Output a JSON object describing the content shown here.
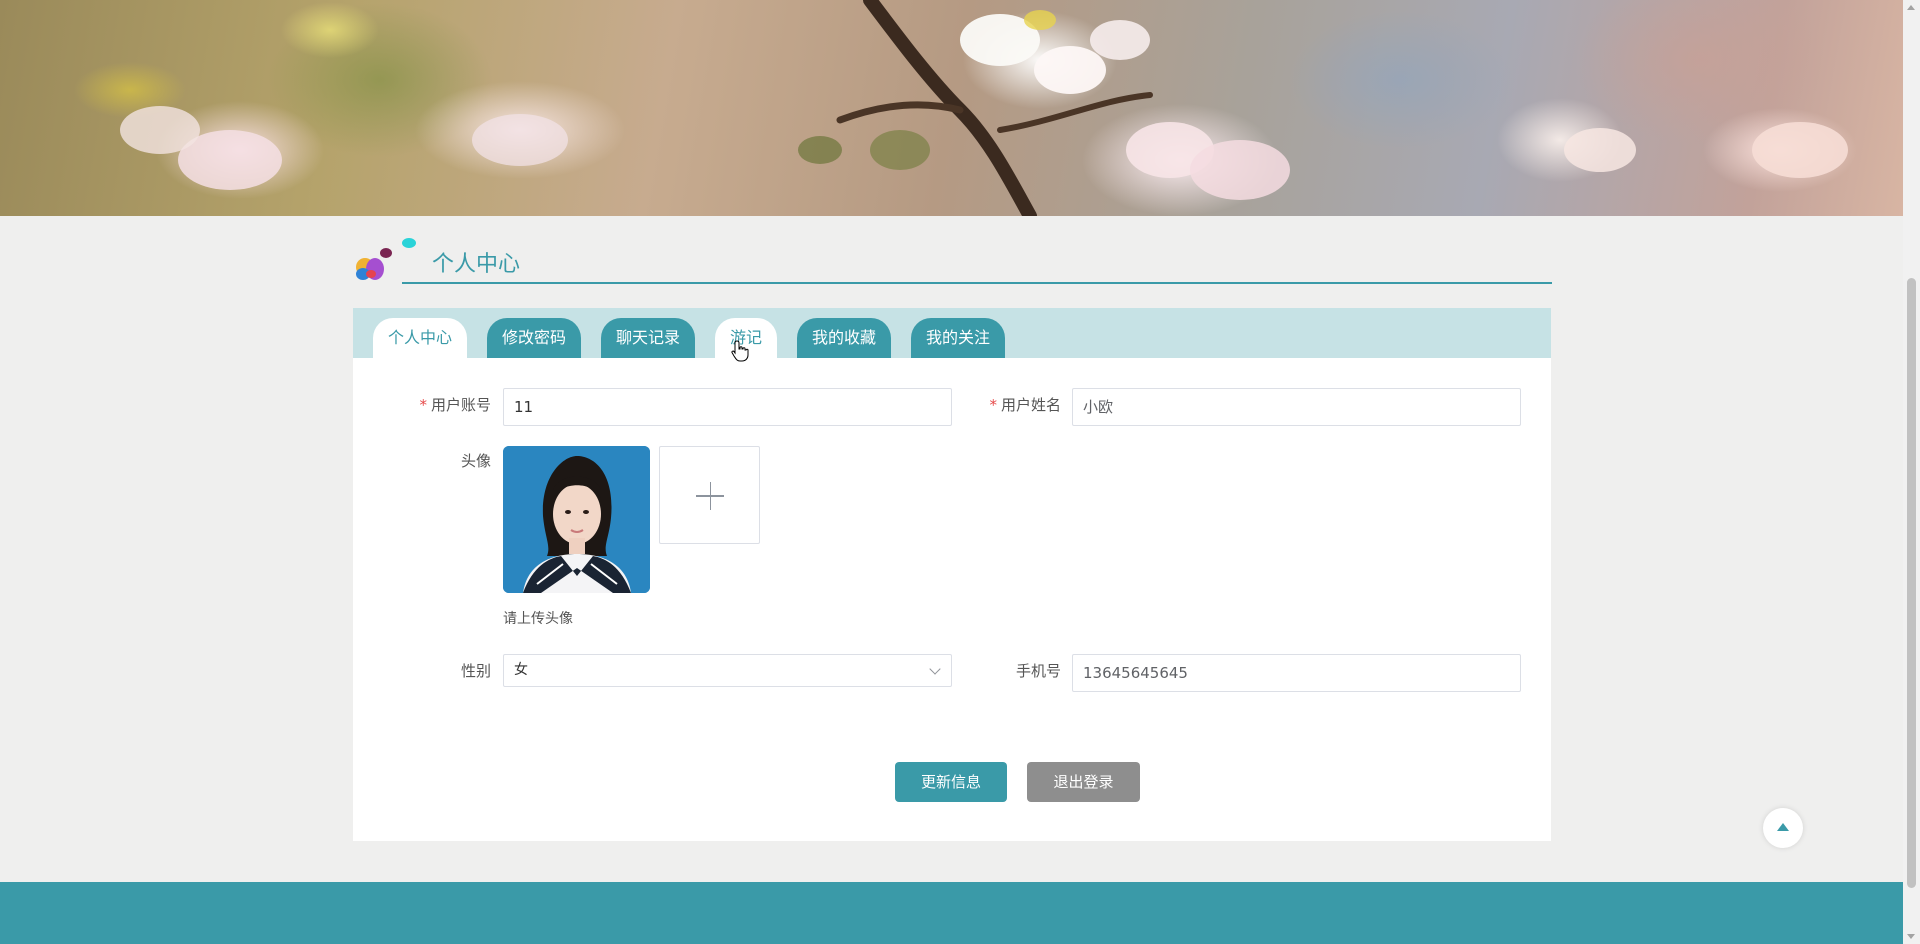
{
  "page": {
    "section_title": "个人中心",
    "accent_color": "#3a9aa8"
  },
  "tabs": [
    {
      "label": "个人中心",
      "active": true
    },
    {
      "label": "修改密码",
      "active": false
    },
    {
      "label": "聊天记录",
      "active": false
    },
    {
      "label": "游记",
      "active": true
    },
    {
      "label": "我的收藏",
      "active": false
    },
    {
      "label": "我的关注",
      "active": false
    }
  ],
  "form": {
    "account_label": "用户账号",
    "account_value": "11",
    "name_label": "用户姓名",
    "name_value": "小欧",
    "avatar_label": "头像",
    "avatar_hint": "请上传头像",
    "gender_label": "性别",
    "gender_value": "女",
    "phone_label": "手机号",
    "phone_value": "13645645645",
    "required_mark": "*"
  },
  "buttons": {
    "update": "更新信息",
    "logout": "退出登录"
  },
  "icons": {
    "upload": "plus-icon",
    "back_to_top": "arrow-up-icon",
    "select": "chevron-down-icon",
    "cursor": "hand-pointer-icon"
  }
}
